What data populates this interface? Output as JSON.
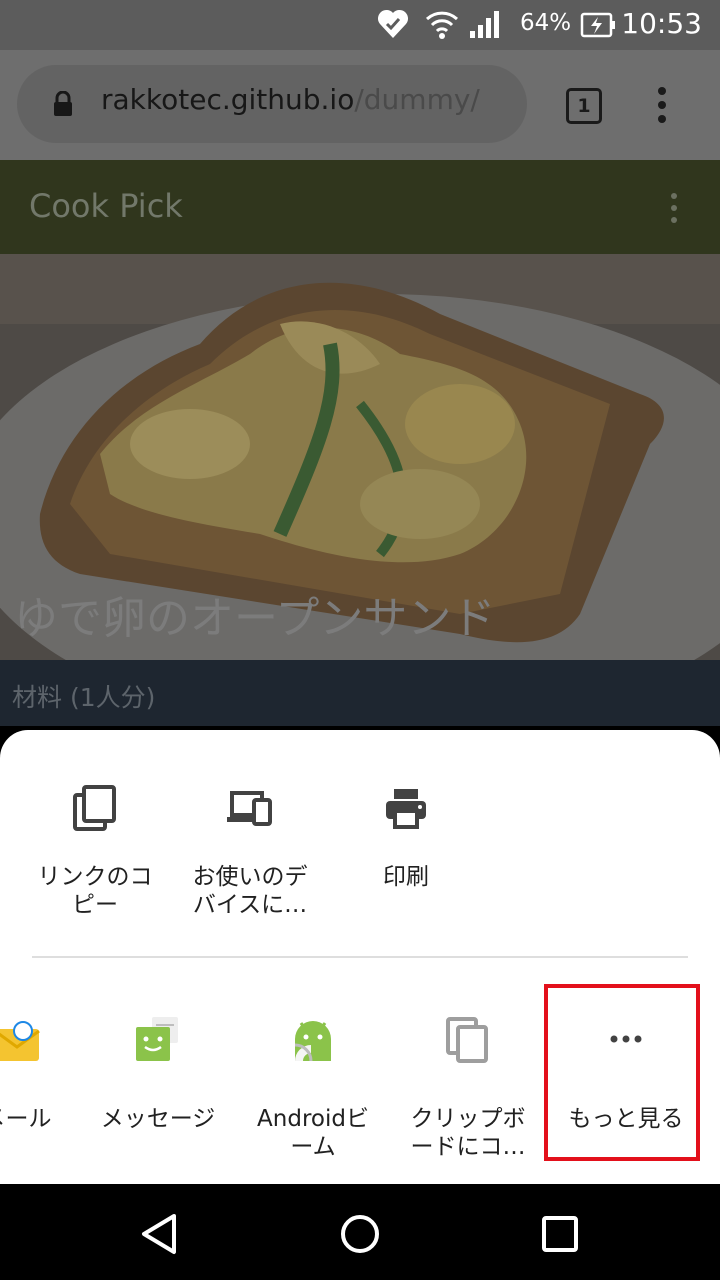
{
  "status_bar": {
    "battery_percent": "64%",
    "time": "10:53"
  },
  "browser": {
    "url_host": "rakkotec.github.io",
    "url_path": "/dummy/",
    "tab_count": "1"
  },
  "app_bar": {
    "title": "Cook Pick"
  },
  "hero": {
    "title": "ゆで卵のオープンサンド"
  },
  "section": {
    "label": "材料 (1人分)"
  },
  "share_sheet": {
    "options": [
      {
        "label": "リンクのコ\nピー",
        "icon": "copy-link-icon"
      },
      {
        "label": "お使いのデ\nバイスに…",
        "icon": "send-to-devices-icon"
      },
      {
        "label": "印刷",
        "icon": "print-icon"
      }
    ],
    "apps": [
      {
        "label": "メール",
        "icon": "mail-icon"
      },
      {
        "label": "メッセージ",
        "icon": "messages-icon"
      },
      {
        "label": "Androidビ\nーム",
        "icon": "android-beam-icon"
      },
      {
        "label": "クリップボ\nードにコ…",
        "icon": "clipboard-icon"
      },
      {
        "label": "もっと見る",
        "icon": "more-horiz-icon"
      }
    ]
  },
  "colors": {
    "highlight": "#e3101b",
    "app_bar": "#30361d",
    "android_green": "#8bc34a"
  }
}
